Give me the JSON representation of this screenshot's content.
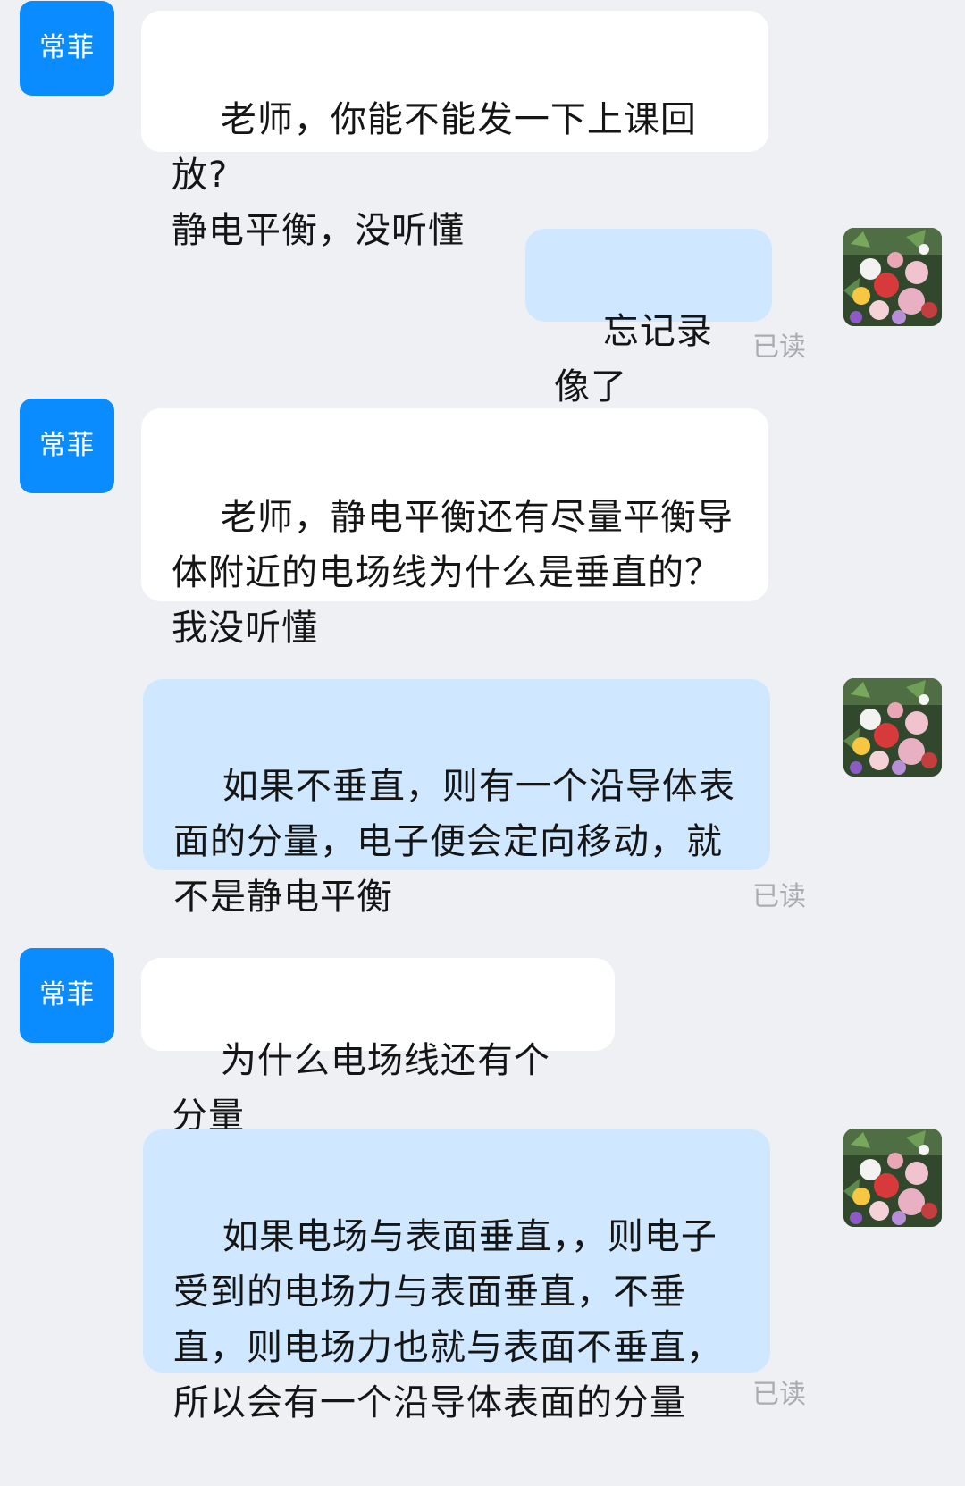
{
  "contact": {
    "name": "常菲"
  },
  "messages": [
    {
      "direction": "in",
      "text": "老师，你能不能发一下上课回放?\n静电平衡，没听懂"
    },
    {
      "direction": "out",
      "text": "忘记录像了",
      "status": "已读"
    },
    {
      "direction": "in",
      "text": "老师，静电平衡还有尽量平衡导体附近的电场线为什么是垂直的？我没听懂"
    },
    {
      "direction": "out",
      "text": "如果不垂直，则有一个沿导体表面的分量，电子便会定向移动，就不是静电平衡",
      "status": "已读"
    },
    {
      "direction": "in",
      "text": "为什么电场线还有个分量"
    },
    {
      "direction": "out",
      "text": "如果电场与表面垂直，，则电子受到的电场力与表面垂直，不垂直，则电场力也就与表面不垂直，所以会有一个沿导体表面的分量",
      "status": "已读"
    }
  ],
  "colors": {
    "background": "#eef0f4",
    "incoming_bubble": "#ffffff",
    "outgoing_bubble": "#cfe8ff",
    "avatar_badge": "#0a8cff",
    "read_status": "#a9adb3"
  },
  "icons": {
    "self_avatar": "flower-bouquet-photo"
  }
}
